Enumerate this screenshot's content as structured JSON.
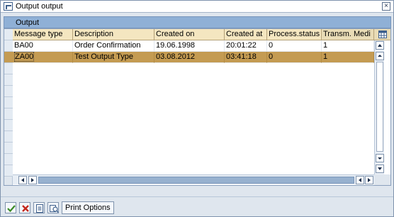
{
  "window": {
    "title": "Output output"
  },
  "group": {
    "title": "Output"
  },
  "table": {
    "columns": [
      "Message type",
      "Description",
      "Created on",
      "Created at",
      "Process.status",
      "Transm. Medi"
    ],
    "rows": [
      [
        "BA00",
        "Order Confirmation",
        "19.06.1998",
        "20:01:22",
        "0",
        "1"
      ],
      [
        "ZA00",
        "Test Output Type",
        "03.08.2012",
        "03:41:18",
        "0",
        "1"
      ]
    ],
    "selected_row": 1
  },
  "toolbar": {
    "print_options_label": "Print Options"
  },
  "colors": {
    "header_bg": "#f4e6c0",
    "selected_row": "#c49b52",
    "group_header": "#8fb0d6"
  }
}
